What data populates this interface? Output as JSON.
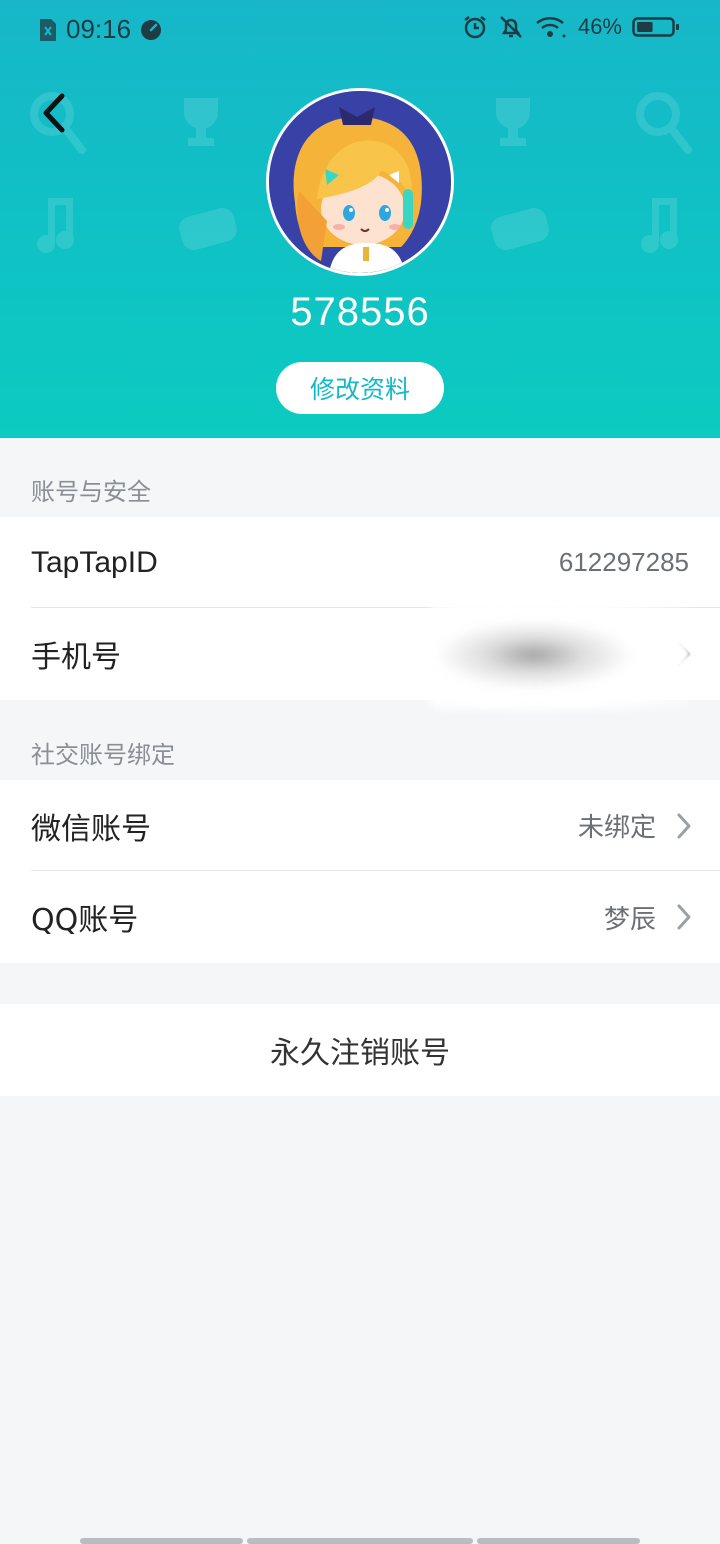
{
  "status_bar": {
    "time": "09:16",
    "battery_percent": "46%",
    "battery_level": 0.46
  },
  "profile": {
    "username": "578556",
    "edit_button_label": "修改资料"
  },
  "account_security": {
    "section_title": "账号与安全",
    "taptap_id_label": "TapTapID",
    "taptap_id_value": "612297285",
    "phone_label": "手机号"
  },
  "social_binding": {
    "section_title": "社交账号绑定",
    "wechat_label": "微信账号",
    "wechat_value": "未绑定",
    "qq_label": "QQ账号",
    "qq_value": "梦辰"
  },
  "delete_account": {
    "label": "永久注销账号"
  },
  "colors": {
    "header_gradient_top": "#17b7c9",
    "header_gradient_bottom": "#0ccbc0",
    "accent": "#14b9c6",
    "page_background": "#f5f6f8"
  }
}
